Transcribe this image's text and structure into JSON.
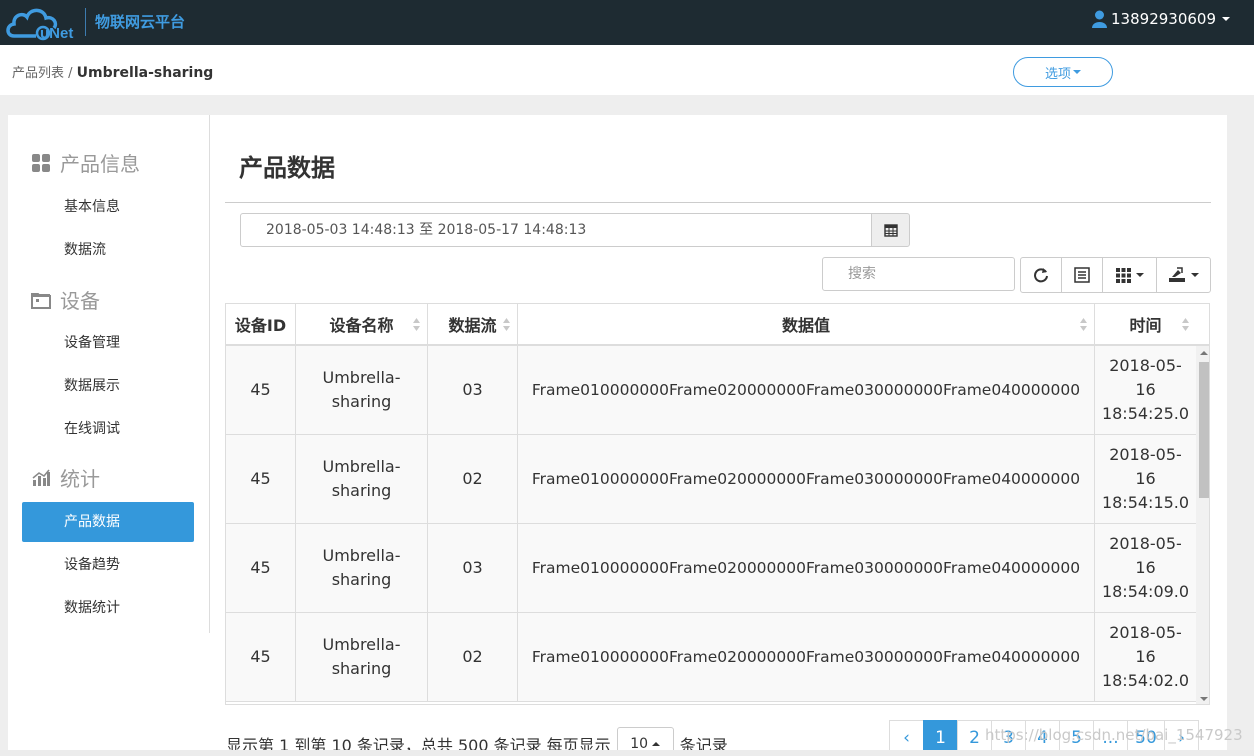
{
  "header": {
    "brand": "物联网云平台",
    "logo_text": "uNet",
    "user": "13892930609",
    "colors": {
      "bar": "#1e2b32",
      "brand": "#3f9be0"
    }
  },
  "breadcrumb": {
    "parent": "产品列表 /",
    "current": "Umbrella-sharing"
  },
  "options_button": "选项",
  "sidebar": {
    "sections": [
      {
        "title": "产品信息",
        "icon": "grid-icon"
      },
      {
        "title": "设备",
        "icon": "folder-icon"
      },
      {
        "title": "统计",
        "icon": "bar-chart-icon"
      }
    ],
    "items": [
      {
        "label": "基本信息"
      },
      {
        "label": "数据流"
      },
      {
        "label": "设备管理"
      },
      {
        "label": "数据展示"
      },
      {
        "label": "在线调试"
      },
      {
        "label": "产品数据",
        "active": true
      },
      {
        "label": "设备趋势"
      },
      {
        "label": "数据统计"
      }
    ]
  },
  "main": {
    "title": "产品数据",
    "date_range": "2018-05-03 14:48:13 至 2018-05-17 14:48:13",
    "search_placeholder": "搜索",
    "table": {
      "columns": [
        "设备ID",
        "设备名称",
        "数据流",
        "数据值",
        "时间"
      ],
      "rows": [
        {
          "id": "45",
          "name": "Umbrella-sharing",
          "stream": "03",
          "value": "Frame010000000Frame020000000Frame030000000Frame040000000",
          "time": "2018-05-16 18:54:25.0"
        },
        {
          "id": "45",
          "name": "Umbrella-sharing",
          "stream": "02",
          "value": "Frame010000000Frame020000000Frame030000000Frame040000000",
          "time": "2018-05-16 18:54:15.0"
        },
        {
          "id": "45",
          "name": "Umbrella-sharing",
          "stream": "03",
          "value": "Frame010000000Frame020000000Frame030000000Frame040000000",
          "time": "2018-05-16 18:54:09.0"
        },
        {
          "id": "45",
          "name": "Umbrella-sharing",
          "stream": "02",
          "value": "Frame010000000Frame020000000Frame030000000Frame040000000",
          "time": "2018-05-16 18:54:02.0"
        }
      ]
    },
    "footer": {
      "info": "显示第 1 到第 10 条记录，总共 500 条记录 每页显示",
      "page_size": "10",
      "suffix": "条记录"
    },
    "pagination": [
      "‹",
      "1",
      "2",
      "3",
      "4",
      "5",
      "...",
      "50",
      "›"
    ],
    "active_page": "1"
  },
  "watermark": "https://blog.csdn.net/bai_1547923"
}
